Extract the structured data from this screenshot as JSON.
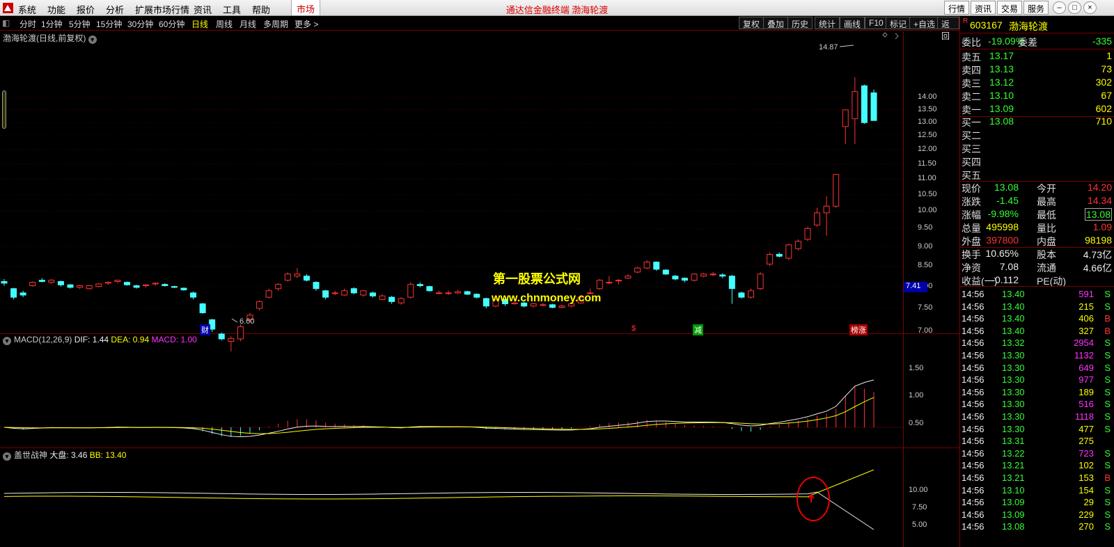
{
  "menu": {
    "items": [
      "系统",
      "功能",
      "报价",
      "分析",
      "扩展市场行情",
      "资讯",
      "工具",
      "帮助"
    ],
    "market": "市场",
    "title": "通达信金融终端  渤海轮渡",
    "right_buttons": [
      "行情",
      "资讯",
      "交易",
      "服务"
    ]
  },
  "toolbar": {
    "periods": [
      "分时",
      "1分钟",
      "5分钟",
      "15分钟",
      "30分钟",
      "60分钟",
      "日线",
      "周线",
      "月线",
      "多周期",
      "更多 >"
    ],
    "active": "日线",
    "tools": [
      "复权",
      "叠加",
      "历史",
      "统计",
      "画线",
      "F10",
      "标记",
      "+自选",
      "返回"
    ]
  },
  "main_chart": {
    "title": "渤海轮渡(日线,前复权)",
    "price_labels": [
      "14.00",
      "13.50",
      "13.00",
      "12.50",
      "12.00",
      "11.50",
      "11.00",
      "10.50",
      "10.00",
      "9.50",
      "9.00",
      "8.50",
      "8.00",
      "7.50",
      "7.00"
    ],
    "high_label": "14.87",
    "low_label": "6.60",
    "current_price_tag": "7.41",
    "markers": [
      "财",
      "$",
      "减",
      "榜涨"
    ],
    "watermark_title": "第一股票公式网",
    "watermark_url": "www.chnmoney.com"
  },
  "macd": {
    "title": "MACD(12,26,9)",
    "dif_label": "DIF: 1.44",
    "dea_label": "DEA: 0.94",
    "macd_label": "MACD: 1.00",
    "axis": [
      "1.50",
      "1.00",
      "0.50"
    ]
  },
  "indicator": {
    "title": "盖世战神",
    "dapan_label": "大盘: 3.46",
    "bb_label": "BB: 13.40",
    "axis": [
      "10.00",
      "7.50",
      "5.00"
    ]
  },
  "quote": {
    "code": "603167",
    "name": "渤海轮渡",
    "weibi": {
      "label": "委比",
      "value": "-19.09%",
      "label2": "委差",
      "value2": "-335"
    },
    "asks": [
      {
        "label": "卖五",
        "price": "13.17",
        "vol": "1"
      },
      {
        "label": "卖四",
        "price": "13.13",
        "vol": "73"
      },
      {
        "label": "卖三",
        "price": "13.12",
        "vol": "302"
      },
      {
        "label": "卖二",
        "price": "13.10",
        "vol": "67"
      },
      {
        "label": "卖一",
        "price": "13.09",
        "vol": "602"
      }
    ],
    "bids": [
      {
        "label": "买一",
        "price": "13.08",
        "vol": "710"
      },
      {
        "label": "买二",
        "price": "",
        "vol": ""
      },
      {
        "label": "买三",
        "price": "",
        "vol": ""
      },
      {
        "label": "买四",
        "price": "",
        "vol": ""
      },
      {
        "label": "买五",
        "price": "",
        "vol": ""
      }
    ],
    "stats": [
      {
        "l1": "现价",
        "v1": "13.08",
        "l2": "今开",
        "v2": "14.20"
      },
      {
        "l1": "涨跌",
        "v1": "-1.45",
        "l2": "最高",
        "v2": "14.34"
      },
      {
        "l1": "涨幅",
        "v1": "-9.98%",
        "l2": "最低",
        "v2": "13.08"
      },
      {
        "l1": "总量",
        "v1": "495998",
        "l2": "量比",
        "v2": "1.09"
      },
      {
        "l1": "外盘",
        "v1": "397800",
        "l2": "内盘",
        "v2": "98198"
      }
    ],
    "stats2": [
      {
        "l1": "换手",
        "v1": "10.65%",
        "l2": "股本",
        "v2": "4.73亿"
      },
      {
        "l1": "净资",
        "v1": "7.08",
        "l2": "流通",
        "v2": "4.66亿"
      },
      {
        "l1": "收益(一)",
        "v1": "-0.112",
        "l2": "PE(动)",
        "v2": ""
      }
    ],
    "ticks": [
      [
        "14:56",
        "13.40",
        "591",
        "S"
      ],
      [
        "14:56",
        "13.40",
        "215",
        "S"
      ],
      [
        "14:56",
        "13.40",
        "406",
        "B"
      ],
      [
        "14:56",
        "13.40",
        "327",
        "B"
      ],
      [
        "14:56",
        "13.32",
        "2954",
        "S"
      ],
      [
        "14:56",
        "13.30",
        "1132",
        "S"
      ],
      [
        "14:56",
        "13.30",
        "649",
        "S"
      ],
      [
        "14:56",
        "13.30",
        "977",
        "S"
      ],
      [
        "14:56",
        "13.30",
        "189",
        "S"
      ],
      [
        "14:56",
        "13.30",
        "516",
        "S"
      ],
      [
        "14:56",
        "13.30",
        "1118",
        "S"
      ],
      [
        "14:56",
        "13.30",
        "477",
        "S"
      ],
      [
        "14:56",
        "13.31",
        "275",
        ""
      ],
      [
        "14:56",
        "13.22",
        "723",
        "S"
      ],
      [
        "14:56",
        "13.21",
        "102",
        "S"
      ],
      [
        "14:56",
        "13.21",
        "153",
        "B"
      ],
      [
        "14:56",
        "13.10",
        "154",
        "S"
      ],
      [
        "14:56",
        "13.09",
        "29",
        "S"
      ],
      [
        "14:56",
        "13.09",
        "229",
        "S"
      ],
      [
        "14:56",
        "13.08",
        "270",
        "S"
      ]
    ]
  },
  "chart_data": {
    "type": "candlestick",
    "candles": [
      [
        8.12,
        8.08,
        8.18,
        8.02
      ],
      [
        7.95,
        7.75,
        7.97,
        7.7
      ],
      [
        7.85,
        7.8,
        7.9,
        7.75
      ],
      [
        8.02,
        8.1,
        8.12,
        8.0
      ],
      [
        8.15,
        8.12,
        8.2,
        8.1
      ],
      [
        8.1,
        8.15,
        8.18,
        8.06
      ],
      [
        8.12,
        8.04,
        8.14,
        8.0
      ],
      [
        8.04,
        7.98,
        8.06,
        7.95
      ],
      [
        7.98,
        8.02,
        8.04,
        7.94
      ],
      [
        7.95,
        8.02,
        8.04,
        7.93
      ],
      [
        8.0,
        8.06,
        8.08,
        7.98
      ],
      [
        8.08,
        8.1,
        8.12,
        8.04
      ],
      [
        8.12,
        8.15,
        8.16,
        8.08
      ],
      [
        8.1,
        8.04,
        8.12,
        8.02
      ],
      [
        8.02,
        7.98,
        8.04,
        7.95
      ],
      [
        8.02,
        8.04,
        8.06,
        7.98
      ],
      [
        8.06,
        8.08,
        8.1,
        8.02
      ],
      [
        8.05,
        8.02,
        8.08,
        8.0
      ],
      [
        8.0,
        7.98,
        8.02,
        7.96
      ],
      [
        7.96,
        7.92,
        7.98,
        7.9
      ],
      [
        7.85,
        7.75,
        7.88,
        7.7
      ],
      [
        7.6,
        7.4,
        7.62,
        7.38
      ],
      [
        7.25,
        7.05,
        7.27,
        6.99
      ],
      [
        6.95,
        6.85,
        6.98,
        6.82
      ],
      [
        6.8,
        6.86,
        6.9,
        6.6
      ],
      [
        6.85,
        7.1,
        7.15,
        6.8
      ],
      [
        7.25,
        7.35,
        7.4,
        7.2
      ],
      [
        7.5,
        7.65,
        7.68,
        7.45
      ],
      [
        7.75,
        7.9,
        7.95,
        7.72
      ],
      [
        7.95,
        8.05,
        8.08,
        7.9
      ],
      [
        8.15,
        8.3,
        8.34,
        8.12
      ],
      [
        8.25,
        8.3,
        8.45,
        8.2
      ],
      [
        8.25,
        8.15,
        8.3,
        8.12
      ],
      [
        8.1,
        7.95,
        8.12,
        7.9
      ],
      [
        7.9,
        7.75,
        7.92,
        7.7
      ],
      [
        7.85,
        7.85,
        7.9,
        7.8
      ],
      [
        7.8,
        7.9,
        7.95,
        7.78
      ],
      [
        7.95,
        7.85,
        7.98,
        7.82
      ],
      [
        7.8,
        7.9,
        7.92,
        7.76
      ],
      [
        7.85,
        7.78,
        7.88,
        7.74
      ],
      [
        7.7,
        7.78,
        7.82,
        7.68
      ],
      [
        7.75,
        7.65,
        7.78,
        7.6
      ],
      [
        7.62,
        7.72,
        7.75,
        7.58
      ],
      [
        7.75,
        8.05,
        8.1,
        7.72
      ],
      [
        8.05,
        8.02,
        8.1,
        7.98
      ],
      [
        8.0,
        7.9,
        8.02,
        7.88
      ],
      [
        7.85,
        7.85,
        7.9,
        7.82
      ],
      [
        7.85,
        7.85,
        7.9,
        7.8
      ],
      [
        7.85,
        7.88,
        7.92,
        7.82
      ],
      [
        7.88,
        7.82,
        7.9,
        7.8
      ],
      [
        7.82,
        7.75,
        7.84,
        7.72
      ],
      [
        7.72,
        7.55,
        7.74,
        7.5
      ],
      [
        7.55,
        7.7,
        7.72,
        7.52
      ],
      [
        7.7,
        7.6,
        7.72,
        7.55
      ],
      [
        7.6,
        7.62,
        7.65,
        7.58
      ],
      [
        7.62,
        7.55,
        7.65,
        7.52
      ],
      [
        7.55,
        7.6,
        7.62,
        7.52
      ],
      [
        7.58,
        7.58,
        7.62,
        7.55
      ],
      [
        7.58,
        7.52,
        7.6,
        7.5
      ],
      [
        7.52,
        7.55,
        7.58,
        7.5
      ],
      [
        7.55,
        7.6,
        7.62,
        7.52
      ],
      [
        7.62,
        7.75,
        7.78,
        7.6
      ],
      [
        7.85,
        7.85,
        7.95,
        7.82
      ],
      [
        7.95,
        8.15,
        8.18,
        7.92
      ],
      [
        8.1,
        8.1,
        8.25,
        8.05
      ],
      [
        8.15,
        8.15,
        8.18,
        8.05
      ],
      [
        8.2,
        8.25,
        8.3,
        8.18
      ],
      [
        8.35,
        8.45,
        8.48,
        8.32
      ],
      [
        8.45,
        8.6,
        8.65,
        8.42
      ],
      [
        8.6,
        8.42,
        8.62,
        8.38
      ],
      [
        8.4,
        8.3,
        8.42,
        8.28
      ],
      [
        8.25,
        8.18,
        8.28,
        8.15
      ],
      [
        8.2,
        8.15,
        8.22,
        8.1
      ],
      [
        8.15,
        8.3,
        8.32,
        8.12
      ],
      [
        8.25,
        8.3,
        8.33,
        8.22
      ],
      [
        8.3,
        8.3,
        8.35,
        8.25
      ],
      [
        8.28,
        8.25,
        8.32,
        8.2
      ],
      [
        8.25,
        7.95,
        8.28,
        7.6
      ],
      [
        7.85,
        7.75,
        7.88,
        7.72
      ],
      [
        7.75,
        7.9,
        7.95,
        7.72
      ],
      [
        7.95,
        8.3,
        8.35,
        7.92
      ],
      [
        8.55,
        8.8,
        8.85,
        8.5
      ],
      [
        8.8,
        8.75,
        8.85,
        8.72
      ],
      [
        8.7,
        9.05,
        9.08,
        8.65
      ],
      [
        8.95,
        9.15,
        9.2,
        8.9
      ],
      [
        9.2,
        9.5,
        9.55,
        9.15
      ],
      [
        9.6,
        9.95,
        10.1,
        9.55
      ],
      [
        9.95,
        10.15,
        10.45,
        9.3
      ],
      [
        10.15,
        11.15,
        11.15,
        10.1
      ],
      [
        12.85,
        13.5,
        13.5,
        12.2
      ],
      [
        13.15,
        14.25,
        14.87,
        12.2
      ],
      [
        14.5,
        13.0,
        14.55,
        12.95
      ],
      [
        14.2,
        13.08,
        14.34,
        13.08
      ]
    ]
  }
}
